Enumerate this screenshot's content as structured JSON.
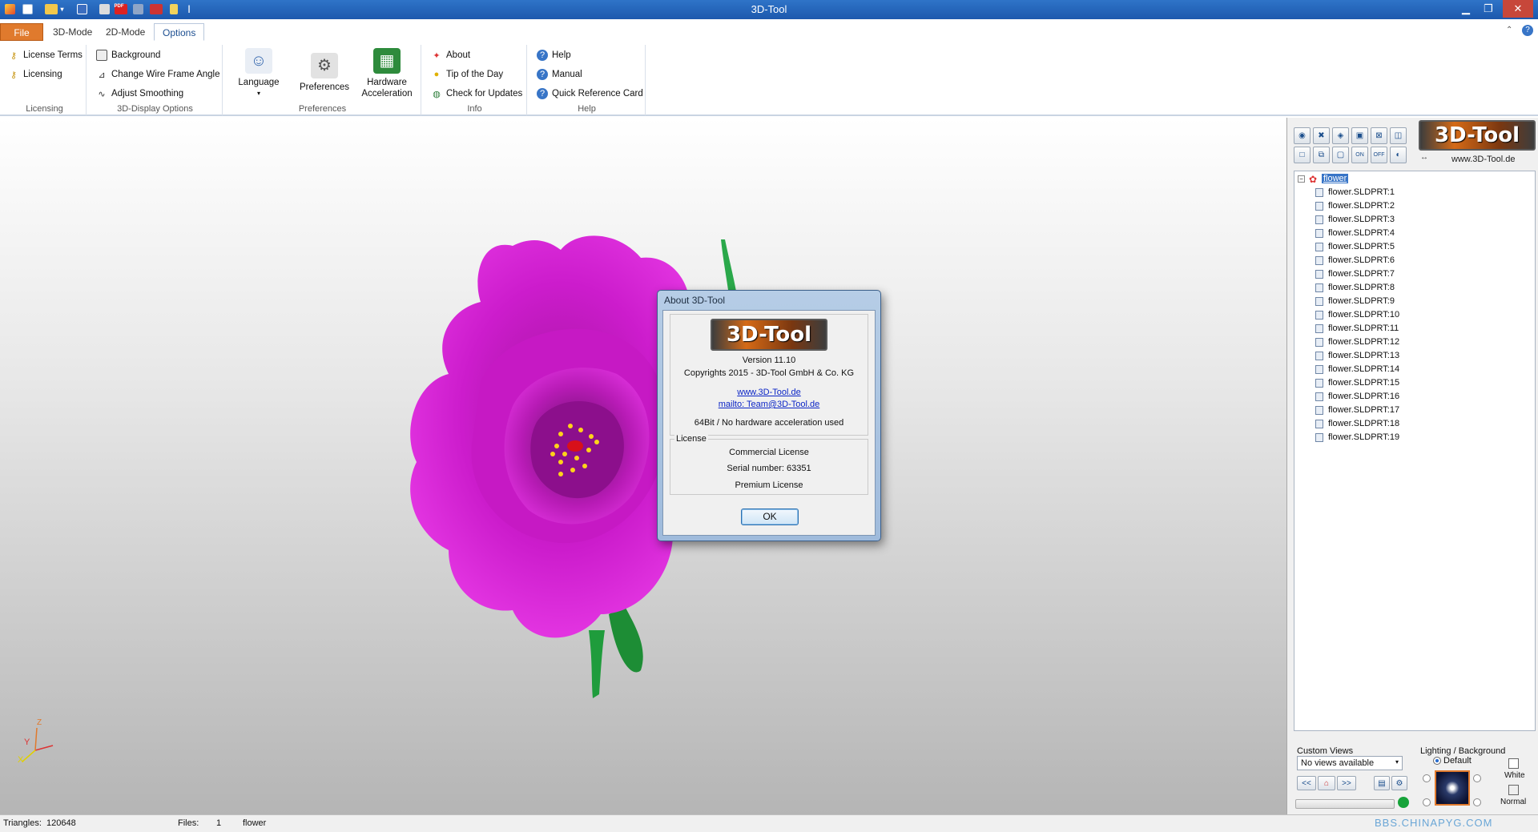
{
  "window": {
    "title": "3D-Tool"
  },
  "tabs": [
    {
      "label": "File"
    },
    {
      "label": "3D-Mode"
    },
    {
      "label": "2D-Mode"
    },
    {
      "label": "Options"
    }
  ],
  "ribbon": {
    "licensing": {
      "label": "Licensing",
      "items": [
        "License Terms",
        "Licensing"
      ]
    },
    "display_options": {
      "label": "3D-Display Options",
      "items": [
        "Background",
        "Change Wire Frame Angle",
        "Adjust Smoothing"
      ]
    },
    "preferences": {
      "label": "Preferences",
      "language": "Language",
      "preferences": "Preferences",
      "hardware_line1": "Hardware",
      "hardware_line2": "Acceleration"
    },
    "info": {
      "label": "Info",
      "items": [
        "About",
        "Tip of the Day",
        "Check for Updates"
      ]
    },
    "help": {
      "label": "Help",
      "items": [
        "Help",
        "Manual",
        "Quick Reference Card"
      ]
    }
  },
  "about_dialog": {
    "title": "About 3D-Tool",
    "logo": "3D-Tool",
    "version": "Version 11.10",
    "copyright": "Copyrights 2015 - 3D-Tool GmbH & Co. KG",
    "website": "www.3D-Tool.de",
    "email": "mailto: Team@3D-Tool.de",
    "build_info": "64Bit / No hardware acceleration used",
    "license_label": "License",
    "license_type": "Commercial License",
    "serial": "Serial number: 63351",
    "edition": "Premium License",
    "ok_label": "OK"
  },
  "panel": {
    "logo": "3D-Tool",
    "website": "www.3D-Tool.de",
    "tree_root": "flower",
    "tree_items": [
      "flower.SLDPRT:1",
      "flower.SLDPRT:2",
      "flower.SLDPRT:3",
      "flower.SLDPRT:4",
      "flower.SLDPRT:5",
      "flower.SLDPRT:6",
      "flower.SLDPRT:7",
      "flower.SLDPRT:8",
      "flower.SLDPRT:9",
      "flower.SLDPRT:10",
      "flower.SLDPRT:11",
      "flower.SLDPRT:12",
      "flower.SLDPRT:13",
      "flower.SLDPRT:14",
      "flower.SLDPRT:15",
      "flower.SLDPRT:16",
      "flower.SLDPRT:17",
      "flower.SLDPRT:18",
      "flower.SLDPRT:19"
    ],
    "custom_views_label": "Custom Views",
    "custom_views_value": "No views available",
    "prev_label": "<<",
    "next_label": ">>",
    "lighting_label": "Lighting / Background",
    "lighting_default": "Default",
    "white_label": "White",
    "normal_label": "Normal"
  },
  "axes": {
    "x": "X",
    "y": "Y",
    "z": "Z"
  },
  "status": {
    "triangles_label": "Triangles:",
    "triangles_value": "120648",
    "files_label": "Files:",
    "files_value": "1",
    "file_name": "flower"
  },
  "watermark": "BBS.CHINAPYG.COM",
  "colors": {
    "accent": "#e07a2d",
    "titlebar": "#2366bb",
    "flower": "#cc1ccc"
  }
}
